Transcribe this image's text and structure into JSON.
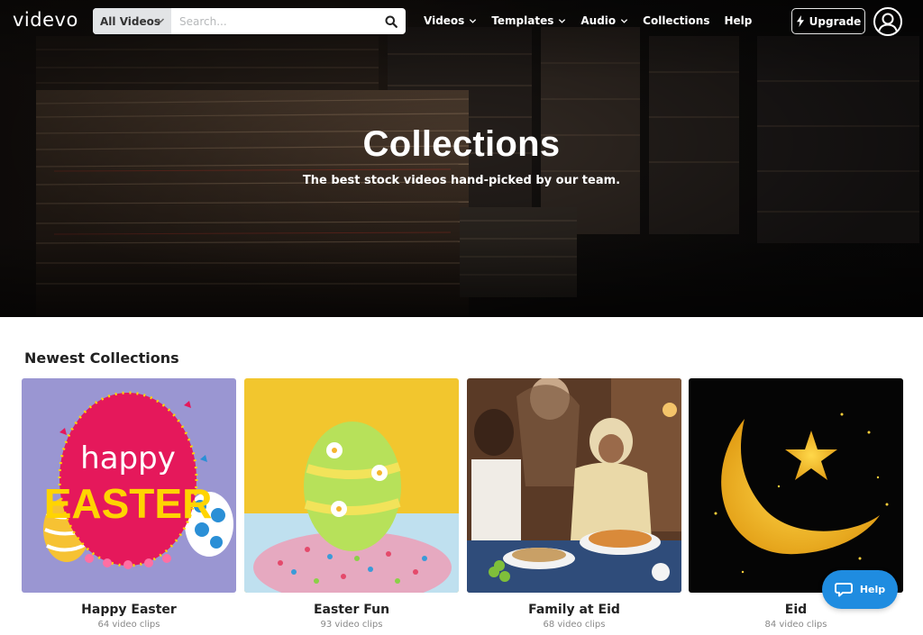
{
  "nav": {
    "logo": "videvo",
    "search": {
      "category": "All Videos",
      "placeholder": "Search..."
    },
    "links": [
      "Videos",
      "Templates",
      "Audio",
      "Collections",
      "Help"
    ],
    "upgrade_label": "Upgrade"
  },
  "hero": {
    "title": "Collections",
    "subtitle": "The best stock videos hand-picked by our team."
  },
  "section": {
    "title": "Newest Collections",
    "cards": [
      {
        "title": "Happy Easter",
        "count": "64 video clips",
        "thumb_text_1": "happy",
        "thumb_text_2": "EASTER"
      },
      {
        "title": "Easter Fun",
        "count": "93 video clips"
      },
      {
        "title": "Family at Eid",
        "count": "68 video clips"
      },
      {
        "title": "Eid",
        "count": "84 video clips"
      }
    ]
  },
  "help_button": {
    "label": "Help",
    "color": "#1f8ce0"
  }
}
